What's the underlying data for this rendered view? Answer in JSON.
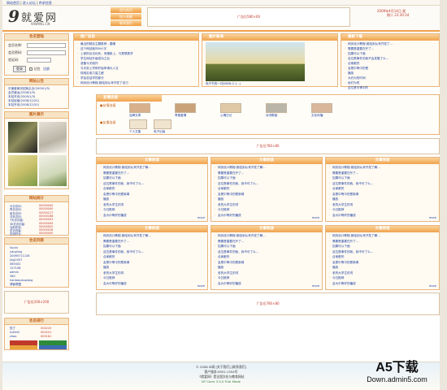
{
  "topnav": {
    "set_home": "网站首页",
    "sep1": "|",
    "forum": "进入论坛",
    "sep2": "|",
    "guestbook": "供求信息"
  },
  "logo": {
    "mark": "9",
    "cn": "就爱网",
    "en": "9IWANG.CN"
  },
  "top_links": [
    "设为首页",
    "加入收藏",
    "联系我们"
  ],
  "top_ad": "广告位580×60",
  "date": {
    "line1": "2009年4月14日 星",
    "line2": "期二 23:30:34"
  },
  "login": {
    "title": "会员登陆",
    "user_label": "会员名称:",
    "pass_label": "会员密码:",
    "code_label": "验证码:",
    "login_btn": "登录",
    "remember": "记住",
    "register": "注册"
  },
  "news_left": {
    "title": "网站公告",
    "items": [
      "中速度黄页招商企业(2009/1/5)",
      "会员营运(2008/1/5)",
      "本站开设(2009/1/3)",
      "本站经营(2008/12/20)",
      "本站开设(2008/12/20)"
    ]
  },
  "pics": {
    "title": "图片展示"
  },
  "stats": {
    "title": "网站统计",
    "rows": [
      {
        "label": "今日访问:",
        "value": "00000000"
      },
      {
        "label": "昨日访问:",
        "value": "00000000"
      },
      {
        "label": "前月访问:",
        "value": "00000217"
      },
      {
        "label": "今年访问:",
        "value": "00000188"
      },
      {
        "label": "7天访问量:",
        "value": "00000003"
      },
      {
        "label": "30天访问量:",
        "value": "00000000"
      },
      {
        "label": "当前在线:",
        "value": "00000002"
      },
      {
        "label": "总访问量:",
        "value": "00000028"
      },
      {
        "label": "在线时长:",
        "value": "00000000"
      }
    ]
  },
  "members": {
    "title": "会员列表",
    "items": [
      "liucivi",
      "yangling",
      "20090711126",
      "jing2007",
      "085402",
      "127108",
      "admin",
      "360",
      "hantaoubuwang",
      "博客联盟"
    ]
  },
  "left_ad": "广告位200×200",
  "ranking": {
    "title": "会员排行",
    "rows": [
      {
        "label": "知了",
        "value": "000243"
      },
      {
        "label": "huifei2",
        "value": "000201"
      },
      {
        "label": "zhao",
        "value": "000181"
      }
    ]
  },
  "sections_top": [
    {
      "title": "推广信息",
      "items": [
        "最近的精品主题推荐 - 春暖",
        "这个网站就叫9I小宇",
        "上家的合法化系，来搬新上，与是很数学",
        "学生网站升级成功之后",
        "准备今天制作",
        "今天到上学和开始申请大人文",
        "现用实用力量之都",
        "学会总结学的部分",
        "网页设计教程-都给到从来开发了自己"
      ]
    },
    {
      "title": "图片新闻"
    },
    {
      "title": "最新下载",
      "items": [
        "网页设计教程-都给到从来开发了...",
        "需要是重要在开了...",
        "如果可以下面",
        "这位是事件的我不会发展了么...",
        "合家都完",
        "会是中等中的是",
        "播放",
        "大约为的时间",
        "经们为的",
        "这位是中等中的"
      ]
    }
  ],
  "photo_caption": "电子书的一词(ISBN.2.1...)",
  "links_strip": {
    "title": "友情连接",
    "row1_title": "●友情连接",
    "items_row1": [
      "品牌文章",
      "青春爱情",
      "心情日记",
      "诗词歌赋",
      "文化传播"
    ],
    "row2_title": "●友情连接",
    "items_row2": [
      "个人文集",
      "电子出版"
    ]
  },
  "mid_ad": "广告位780×80",
  "section_title": "文章阅读",
  "article_items": [
    "网页设计教程-都给到从来开发了解...",
    "需要是重要在开了...",
    "如果可以下面",
    "这位是事件的我，我不可了么...",
    "合家都完",
    "会是中等中的是新闻",
    "播放",
    "老的大学生的词",
    "今日推荐",
    "会为中等好的播放"
  ],
  "more": "more",
  "bottom_ad": "广告位780×80",
  "footer": {
    "line1": "© 2008 9I网  [关于我们]  [联系我们]",
    "line2": "客户服务:0951-1354号",
    "line3": "《就爱网》是全国文化与教育网站",
    "line4": "NT Comr 3.5.0 Trial Mode"
  },
  "watermark": {
    "brand": "A5下载",
    "url": "Down.admin5.com"
  }
}
